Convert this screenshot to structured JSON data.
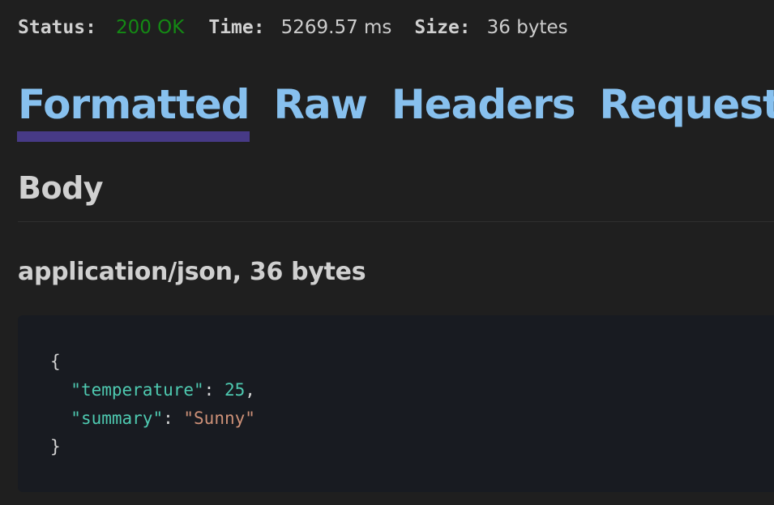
{
  "status_bar": {
    "status_label": "Status:",
    "status_value": "200 OK",
    "time_label": "Time:",
    "time_value": "5269.57 ms",
    "size_label": "Size:",
    "size_value": "36 bytes"
  },
  "tabs": [
    {
      "label": "Formatted",
      "active": true
    },
    {
      "label": "Raw",
      "active": false
    },
    {
      "label": "Headers",
      "active": false
    },
    {
      "label": "Request",
      "active": false
    }
  ],
  "body": {
    "section_title": "Body",
    "content_type": "application/json, 36 bytes",
    "json_lines": {
      "open_brace": "{",
      "key1": "\"temperature\"",
      "colon1": ": ",
      "val1": "25",
      "comma1": ",",
      "key2": "\"summary\"",
      "colon2": ": ",
      "val2": "\"Sunny\"",
      "close_brace": "}"
    }
  },
  "colors": {
    "status_ok": "#148a14",
    "tab_text": "#87c0ee",
    "tab_underline": "#473a86",
    "json_key": "#4ec9b0",
    "json_string": "#ce9178",
    "background": "#1f1f1f",
    "code_background": "#181b21"
  }
}
